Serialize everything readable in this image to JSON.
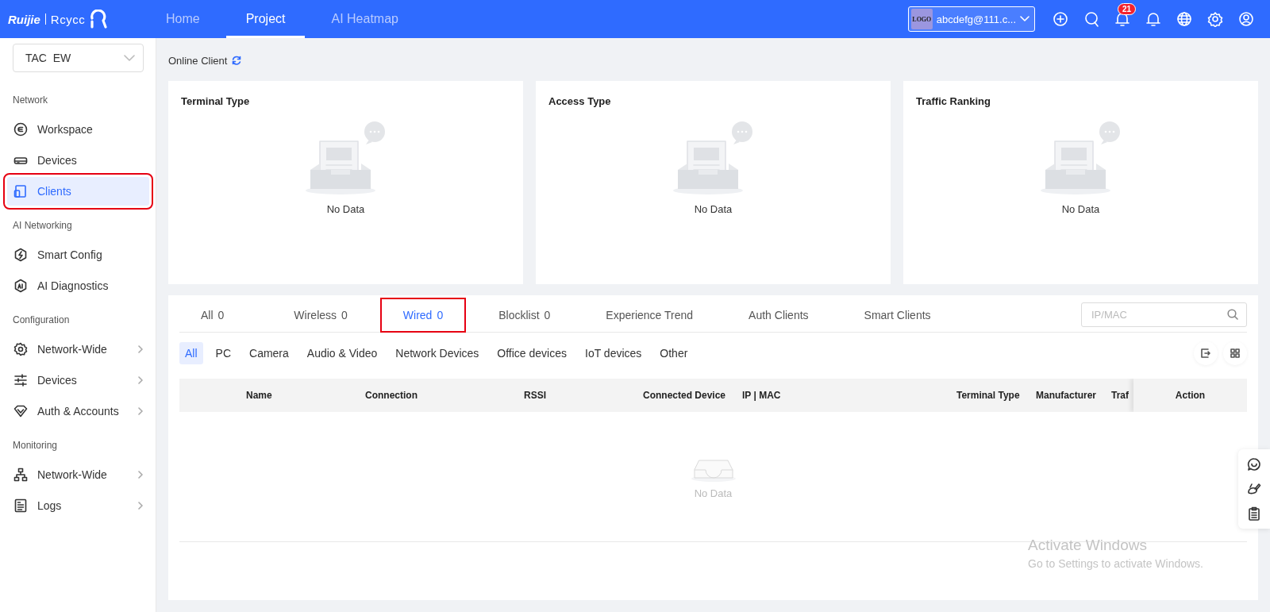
{
  "header": {
    "logo": {
      "brand": "Ruijie",
      "product": "Rcycc"
    },
    "nav": [
      {
        "label": "Home",
        "selected": false
      },
      {
        "label": "Project",
        "selected": true
      },
      {
        "label": "AI Heatmap",
        "selected": false
      }
    ],
    "account": {
      "logo_text": "LOGO",
      "name": "abcdefg@111.c..."
    },
    "notification_badge": "21"
  },
  "sidebar": {
    "project_select": "TAC  EW",
    "groups": [
      {
        "title": "Network",
        "items": [
          {
            "label": "Workspace",
            "selected": false,
            "expandable": false,
            "highlighted": false
          },
          {
            "label": "Devices",
            "selected": false,
            "expandable": false,
            "highlighted": false
          },
          {
            "label": "Clients",
            "selected": true,
            "expandable": false,
            "highlighted": true
          }
        ]
      },
      {
        "title": "AI Networking",
        "items": [
          {
            "label": "Smart Config",
            "selected": false,
            "expandable": false,
            "highlighted": false
          },
          {
            "label": "AI Diagnostics",
            "selected": false,
            "expandable": false,
            "highlighted": false
          }
        ]
      },
      {
        "title": "Configuration",
        "items": [
          {
            "label": "Network-Wide",
            "selected": false,
            "expandable": true,
            "highlighted": false
          },
          {
            "label": "Devices",
            "selected": false,
            "expandable": true,
            "highlighted": false
          },
          {
            "label": "Auth & Accounts",
            "selected": false,
            "expandable": true,
            "highlighted": false
          }
        ]
      },
      {
        "title": "Monitoring",
        "items": [
          {
            "label": "Network-Wide",
            "selected": false,
            "expandable": true,
            "highlighted": false
          },
          {
            "label": "Logs",
            "selected": false,
            "expandable": true,
            "highlighted": false
          }
        ]
      }
    ]
  },
  "page_title": "Online Client",
  "cards": [
    {
      "title": "Terminal Type",
      "empty_text": "No Data"
    },
    {
      "title": "Access Type",
      "empty_text": "No Data"
    },
    {
      "title": "Traffic Ranking",
      "empty_text": "No Data"
    }
  ],
  "client_tabs": [
    {
      "label": "All",
      "count": "0",
      "selected": false,
      "highlighted": false
    },
    {
      "label": "Wireless",
      "count": "0",
      "selected": false,
      "highlighted": false
    },
    {
      "label": "Wired",
      "count": "0",
      "selected": true,
      "highlighted": true
    },
    {
      "label": "Blocklist",
      "count": "0",
      "selected": false,
      "highlighted": false
    },
    {
      "label": "Experience Trend",
      "selected": false,
      "highlighted": false
    },
    {
      "label": "Auth Clients",
      "selected": false,
      "highlighted": false
    },
    {
      "label": "Smart Clients",
      "selected": false,
      "highlighted": false
    }
  ],
  "search": {
    "placeholder": "IP/MAC"
  },
  "filters": [
    {
      "label": "All",
      "selected": true
    },
    {
      "label": "PC",
      "selected": false
    },
    {
      "label": "Camera",
      "selected": false
    },
    {
      "label": "Audio & Video",
      "selected": false
    },
    {
      "label": "Network Devices",
      "selected": false
    },
    {
      "label": "Office devices",
      "selected": false
    },
    {
      "label": "IoT devices",
      "selected": false
    },
    {
      "label": "Other",
      "selected": false
    }
  ],
  "table": {
    "columns": [
      "Name",
      "Connection",
      "RSSI",
      "Connected Device",
      "IP | MAC",
      "Terminal Type",
      "Manufacturer",
      "Traf",
      "Action"
    ],
    "empty_text": "No Data"
  },
  "windows_notice": {
    "title": "Activate Windows",
    "subtitle": "Go to Settings to activate Windows."
  }
}
